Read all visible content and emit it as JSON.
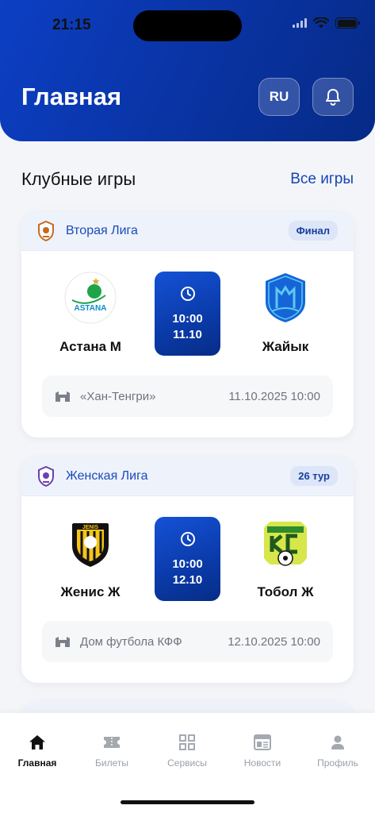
{
  "status": {
    "time": "21:15"
  },
  "header": {
    "title": "Главная",
    "lang": "RU"
  },
  "section": {
    "title": "Клубные игры",
    "all_link": "Все игры"
  },
  "matches": [
    {
      "league": "Вторая Лига",
      "badge": "Финал",
      "home": "Астана М",
      "away": "Жайык",
      "time": "10:00",
      "date": "11.10",
      "venue": "«Хан-Тенгри»",
      "datetime": "11.10.2025 10:00",
      "league_color": "#c56a1e"
    },
    {
      "league": "Женская Лига",
      "badge": "26 тур",
      "home": "Женис Ж",
      "away": "Тобол Ж",
      "time": "10:00",
      "date": "12.10",
      "venue": "Дом футбола КФФ",
      "datetime": "12.10.2025 10:00",
      "league_color": "#6b3fb0"
    }
  ],
  "tabs": [
    {
      "label": "Главная",
      "icon": "home-icon",
      "active": true
    },
    {
      "label": "Билеты",
      "icon": "ticket-icon"
    },
    {
      "label": "Сервисы",
      "icon": "grid-icon"
    },
    {
      "label": "Новости",
      "icon": "news-icon"
    },
    {
      "label": "Профиль",
      "icon": "profile-icon"
    }
  ],
  "colors": {
    "primary": "#0a3aa8",
    "accent_text": "#1544b8",
    "background": "#f4f5f8"
  }
}
